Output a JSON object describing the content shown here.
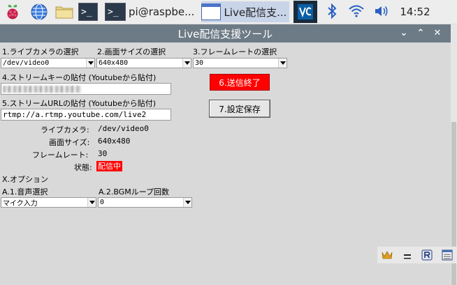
{
  "taskbar": {
    "tasks": [
      {
        "icon": "terminal-icon",
        "label": ""
      },
      {
        "icon": "terminal-icon",
        "label": "pi@raspbe..."
      },
      {
        "icon": "window-icon",
        "label": "Live配信支..."
      }
    ],
    "clock": "14:52",
    "term_glyph": ">_"
  },
  "window": {
    "title": "Live配信支援ツール",
    "controls": {
      "menu": "⌄",
      "maximize": "⌃",
      "close": "✕"
    }
  },
  "form": {
    "camera_label": "1.ライブカメラの選択",
    "camera_value": "/dev/video0",
    "size_label": "2.画面サイズの選択",
    "size_value": "640x480",
    "framerate_label": "3.フレームレートの選択",
    "framerate_value": "30",
    "key_label": "4.ストリームキーの貼付 (Youtubeから貼付)",
    "url_label": "5.ストリームURLの貼付 (Youtubeから貼付)",
    "url_value": "rtmp://a.rtmp.youtube.com/live2",
    "stop_button": "6.送信終了",
    "save_button": "7.設定保存"
  },
  "summary": {
    "camera_label": "ライブカメラ:",
    "camera_value": "/dev/video0",
    "size_label": "画面サイズ:",
    "size_value": "640x480",
    "framerate_label": "フレームレート:",
    "framerate_value": "30",
    "status_label": "状態:",
    "status_value": "配信中"
  },
  "options": {
    "heading": "X.オプション",
    "audio_label": "A.1.音声選択",
    "audio_value": "マイク入力",
    "bgm_label": "A.2.BGMループ回数",
    "bgm_value": "0"
  },
  "colors": {
    "titlebar": "#6d7b86",
    "accent_red": "#ff0000"
  }
}
